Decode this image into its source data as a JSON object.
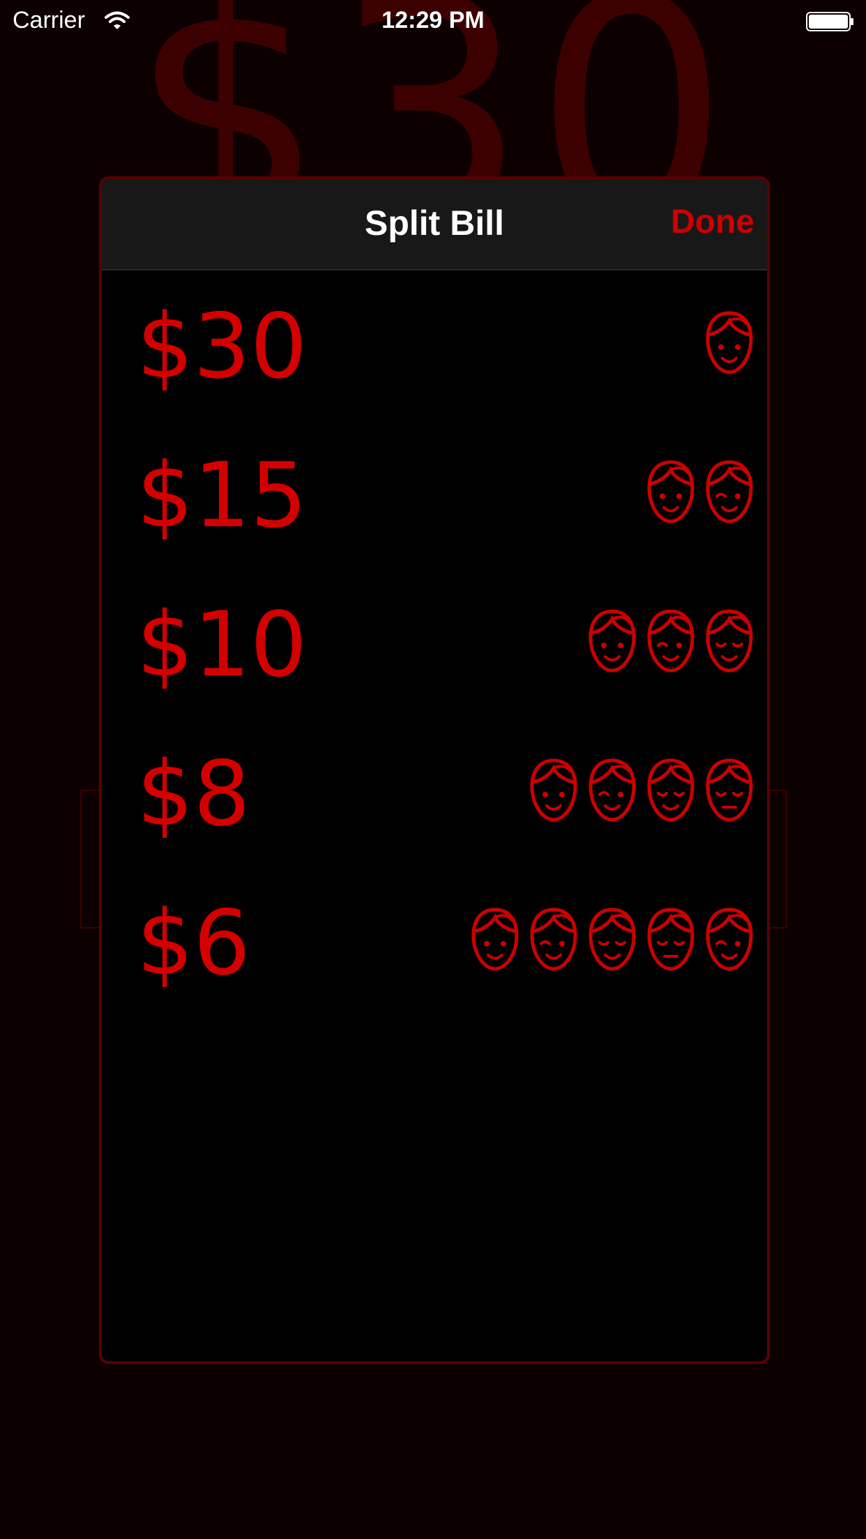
{
  "status_bar": {
    "carrier": "Carrier",
    "time": "12:29 PM"
  },
  "background": {
    "amount": "$30"
  },
  "modal": {
    "title": "Split Bill",
    "done_label": "Done"
  },
  "splits": [
    {
      "amount": "$30",
      "people": 1
    },
    {
      "amount": "$15",
      "people": 2
    },
    {
      "amount": "$10",
      "people": 3
    },
    {
      "amount": "$8",
      "people": 4
    },
    {
      "amount": "$6",
      "people": 5
    }
  ],
  "colors": {
    "accent": "#cc0000",
    "background": "#0d0000",
    "modal_background": "#000000",
    "header_background": "#181818"
  },
  "icons": {
    "face": "person-face-icon",
    "wifi": "wifi-icon",
    "battery": "battery-icon"
  }
}
